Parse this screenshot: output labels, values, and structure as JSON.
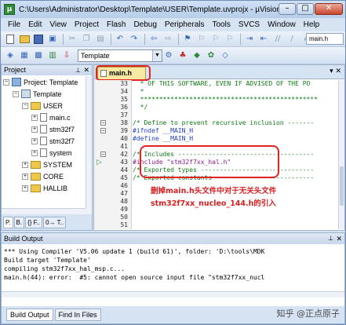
{
  "window": {
    "title": "C:\\Users\\Administrator\\Desktop\\Template\\USER\\Template.uvprojx - µVision",
    "buttons": [
      "–",
      "□",
      "✕"
    ]
  },
  "menu": [
    "File",
    "Edit",
    "View",
    "Project",
    "Flash",
    "Debug",
    "Peripherals",
    "Tools",
    "SVCS",
    "Window",
    "Help"
  ],
  "toolbar": {
    "file_box": "main.h",
    "target": "Template"
  },
  "project_panel": {
    "title": "Project",
    "tree": [
      {
        "label": "Project: Template",
        "level": 0,
        "kind": "project",
        "expanded": true
      },
      {
        "label": "Template",
        "level": 1,
        "kind": "target",
        "expanded": true
      },
      {
        "label": "USER",
        "level": 2,
        "kind": "folder",
        "expanded": true
      },
      {
        "label": "main.c",
        "level": 3,
        "kind": "file"
      },
      {
        "label": "stm32f7",
        "level": 3,
        "kind": "file"
      },
      {
        "label": "stm32f7",
        "level": 3,
        "kind": "file"
      },
      {
        "label": "system",
        "level": 3,
        "kind": "file"
      },
      {
        "label": "SYSTEM",
        "level": 2,
        "kind": "folder"
      },
      {
        "label": "CORE",
        "level": 2,
        "kind": "folder"
      },
      {
        "label": "HALLIB",
        "level": 2,
        "kind": "folder"
      }
    ],
    "tabs": [
      "P.",
      "B.",
      "{} F..",
      "0→ T.."
    ]
  },
  "editor": {
    "tab_label": "main.h",
    "lines": [
      {
        "num": "33",
        "text": "  * OF THIS SOFTWARE, EVEN IF ADVISED OF THE PO",
        "color": "green"
      },
      {
        "num": "34",
        "text": "  *",
        "color": "green"
      },
      {
        "num": "35",
        "text": "  ***********************************************",
        "color": "green"
      },
      {
        "num": "36",
        "text": "  */",
        "color": "green"
      },
      {
        "num": "37",
        "text": "",
        "color": "black"
      },
      {
        "num": "38",
        "text": "/* Define to prevent recursive inclusion -------",
        "color": "green"
      },
      {
        "num": "39",
        "text": "#ifndef __MAIN_H",
        "color": "blue"
      },
      {
        "num": "40",
        "text": "#define __MAIN_H",
        "color": "blue"
      },
      {
        "num": "41",
        "text": "",
        "color": "black"
      },
      {
        "num": "42",
        "text": "/* Includes ------------------------------------",
        "color": "green"
      },
      {
        "num": "43",
        "text": "#include \"stm32f7xx_hal.h\"",
        "color": "purple"
      },
      {
        "num": "44",
        "text": "/* Exported types ------------------------------",
        "color": "green"
      },
      {
        "num": "45",
        "text": "/* Exported constants --------------------------",
        "color": "green"
      },
      {
        "num": "46",
        "text": "",
        "color": "black"
      },
      {
        "num": "47",
        "text": "",
        "color": "black"
      },
      {
        "num": "48",
        "text": "",
        "color": "black"
      },
      {
        "num": "49",
        "text": "",
        "color": "black"
      },
      {
        "num": "50",
        "text": "",
        "color": "black"
      },
      {
        "num": "51",
        "text": "",
        "color": "black"
      }
    ],
    "annotation": [
      "删掉main.h头文件中对于无关头文件",
      "stm32f7xx_nucleo_144.h的引入"
    ]
  },
  "build_output": {
    "title": "Build Output",
    "lines": [
      "*** Using Compiler 'V5.06 update 1 (build 61)', folder: 'D:\\tools\\MDK",
      "Build target 'Template'",
      "compiling stm32f7xx_hal_msp.c...",
      "main.h(44): error:  #5: cannot open source input file \"stm32f7xx_nucl"
    ],
    "tabs": [
      "Build Output",
      "Find In Files"
    ]
  },
  "watermark": "知乎 @正点原子"
}
